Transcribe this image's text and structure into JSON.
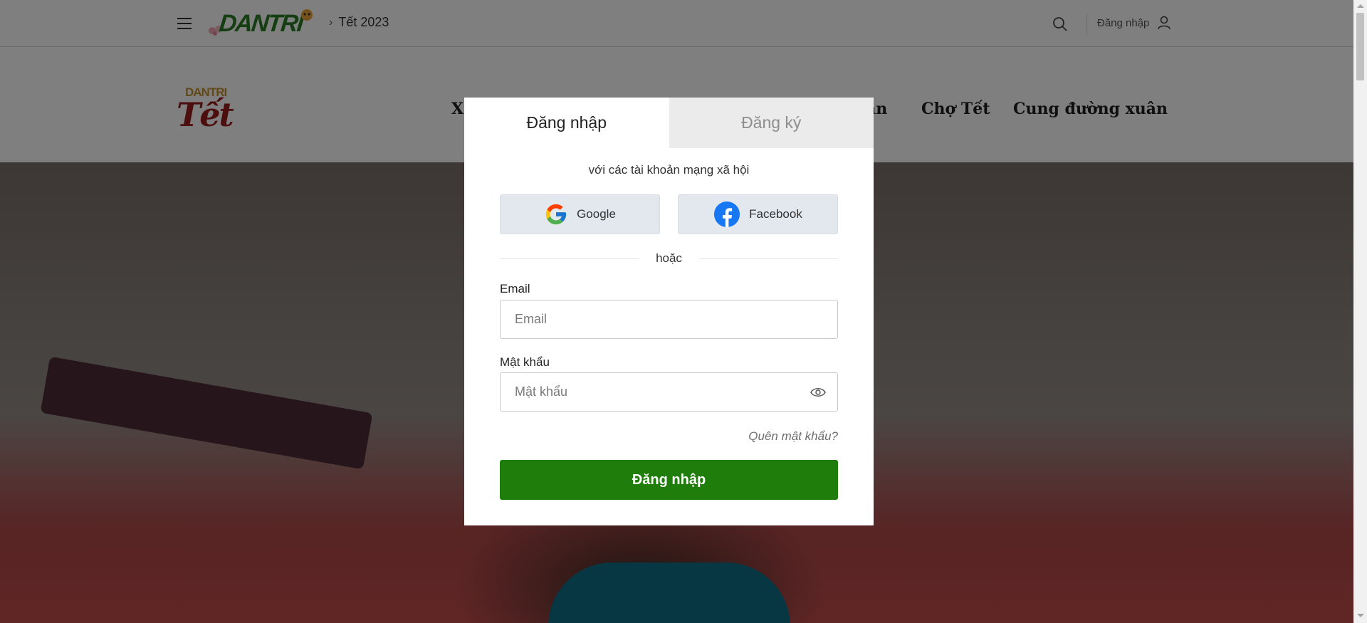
{
  "header": {
    "logo_text": "DANTRI",
    "breadcrumb_separator": "›",
    "breadcrumb": "Tết 2023",
    "login_label": "Đăng nhập"
  },
  "subheader": {
    "logo_small": "DANTRI",
    "logo_big": "Tết",
    "nav_items": [
      "X",
      "àn",
      "Chợ Tết",
      "Cung đường xuân"
    ]
  },
  "modal": {
    "tabs": [
      {
        "label": "Đăng nhập",
        "active": true
      },
      {
        "label": "Đăng ký",
        "active": false
      }
    ],
    "social_caption": "với các tài khoản mạng xã hội",
    "google_label": "Google",
    "facebook_label": "Facebook",
    "or_label": "hoặc",
    "email_label": "Email",
    "email_placeholder": "Email",
    "email_value": "",
    "password_label": "Mật khẩu",
    "password_placeholder": "Mật khẩu",
    "password_value": "",
    "forgot_label": "Quên mật khẩu?",
    "submit_label": "Đăng nhập"
  },
  "icons": {
    "menu": "hamburger-menu-icon",
    "search": "search-icon",
    "user": "user-icon",
    "google": "google-logo-icon",
    "facebook": "facebook-logo-icon",
    "eye": "eye-icon"
  },
  "colors": {
    "brand_green": "#2a7d24",
    "submit_green": "#1f7d0c",
    "tet_red": "#9b1c1c",
    "overlay": "rgba(0,0,0,0.5)"
  }
}
